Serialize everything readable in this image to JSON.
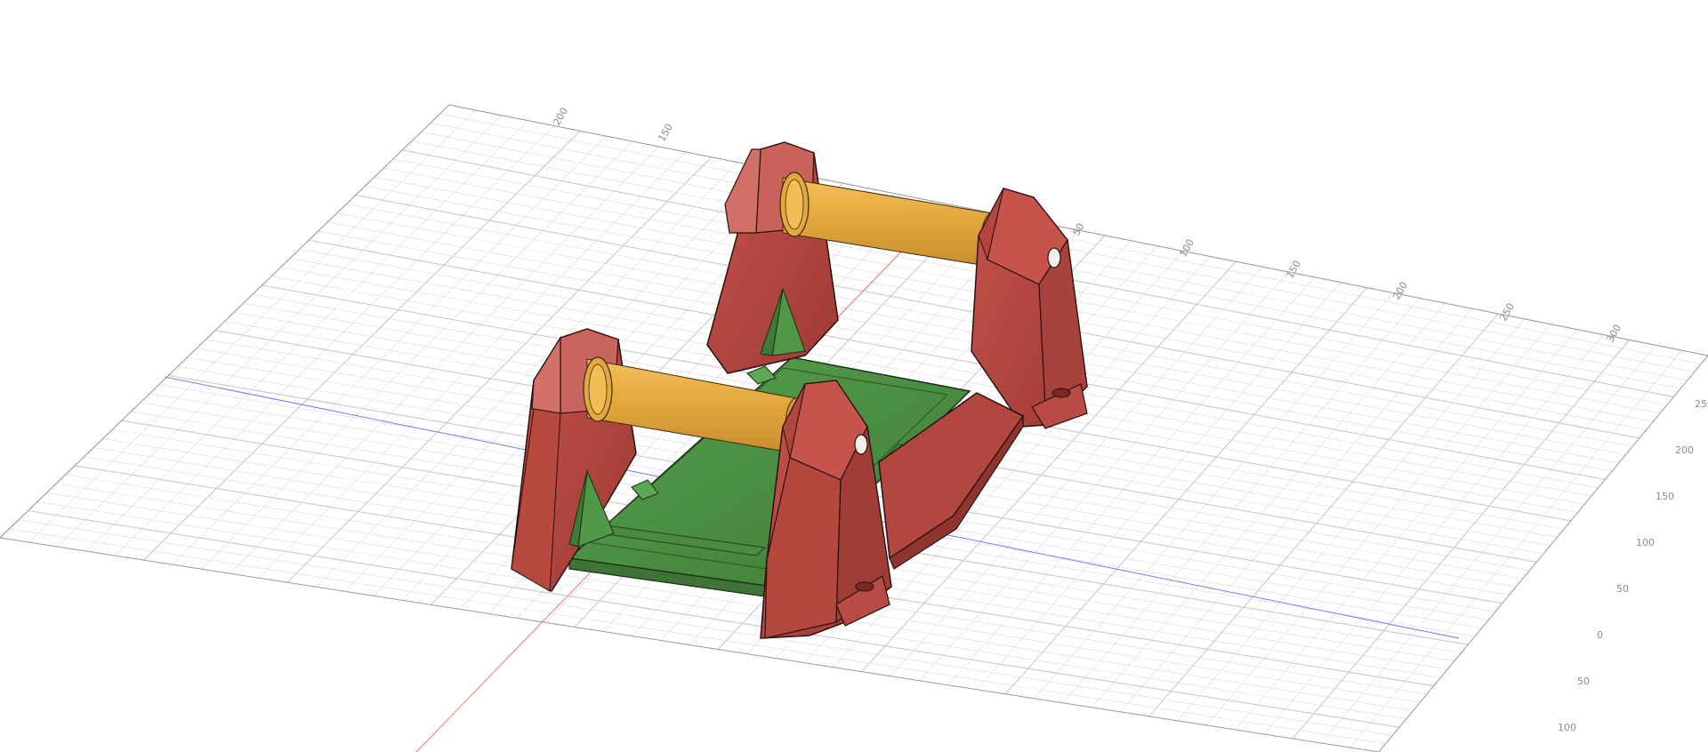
{
  "viewport": {
    "name": "3D model viewport",
    "grid_labels": {
      "top_edge": [
        "200",
        "150"
      ],
      "middle_edge": [
        "50",
        "100",
        "150",
        "200",
        "250",
        "300"
      ],
      "right_edge": [
        "250",
        "200",
        "150",
        "100",
        "50",
        "0",
        "50",
        "100"
      ]
    }
  },
  "model": {
    "frame_color": "#b8463f",
    "base_color": "#4f8d46",
    "roller_color": "#e2a93e",
    "grid_color": "#d9d9d9",
    "axis_x_color": "#6f7fff",
    "axis_y_color": "#ff6d6d"
  }
}
